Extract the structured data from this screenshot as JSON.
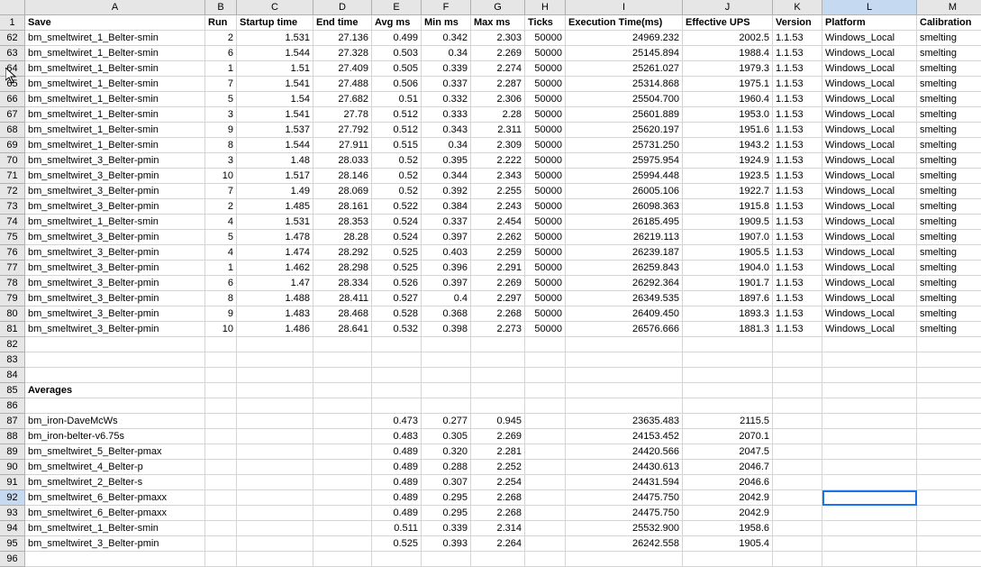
{
  "columns": [
    "",
    "A",
    "B",
    "C",
    "D",
    "E",
    "F",
    "G",
    "H",
    "I",
    "J",
    "K",
    "L",
    "M"
  ],
  "active_column_index": 12,
  "headers": {
    "row": 1,
    "cells": [
      "Save",
      "Run",
      "Startup time",
      "End time",
      "Avg ms",
      "Min ms",
      "Max ms",
      "Ticks",
      "Execution Time(ms)",
      "Effective UPS",
      "Version",
      "Platform",
      "Calibration"
    ]
  },
  "rows": [
    {
      "r": 62,
      "a": "bm_smeltwiret_1_Belter-smin",
      "b": "2",
      "c": "1.531",
      "d": "27.136",
      "e": "0.499",
      "f": "0.342",
      "g": "2.303",
      "h": "50000",
      "i": "24969.232",
      "j": "2002.5",
      "k": "1.1.53",
      "l": "Windows_Local",
      "m": "smelting"
    },
    {
      "r": 63,
      "a": "bm_smeltwiret_1_Belter-smin",
      "b": "6",
      "c": "1.544",
      "d": "27.328",
      "e": "0.503",
      "f": "0.34",
      "g": "2.269",
      "h": "50000",
      "i": "25145.894",
      "j": "1988.4",
      "k": "1.1.53",
      "l": "Windows_Local",
      "m": "smelting"
    },
    {
      "r": 64,
      "a": "bm_smeltwiret_1_Belter-smin",
      "b": "1",
      "c": "1.51",
      "d": "27.409",
      "e": "0.505",
      "f": "0.339",
      "g": "2.274",
      "h": "50000",
      "i": "25261.027",
      "j": "1979.3",
      "k": "1.1.53",
      "l": "Windows_Local",
      "m": "smelting"
    },
    {
      "r": 65,
      "a": "bm_smeltwiret_1_Belter-smin",
      "b": "7",
      "c": "1.541",
      "d": "27.488",
      "e": "0.506",
      "f": "0.337",
      "g": "2.287",
      "h": "50000",
      "i": "25314.868",
      "j": "1975.1",
      "k": "1.1.53",
      "l": "Windows_Local",
      "m": "smelting"
    },
    {
      "r": 66,
      "a": "bm_smeltwiret_1_Belter-smin",
      "b": "5",
      "c": "1.54",
      "d": "27.682",
      "e": "0.51",
      "f": "0.332",
      "g": "2.306",
      "h": "50000",
      "i": "25504.700",
      "j": "1960.4",
      "k": "1.1.53",
      "l": "Windows_Local",
      "m": "smelting"
    },
    {
      "r": 67,
      "a": "bm_smeltwiret_1_Belter-smin",
      "b": "3",
      "c": "1.541",
      "d": "27.78",
      "e": "0.512",
      "f": "0.333",
      "g": "2.28",
      "h": "50000",
      "i": "25601.889",
      "j": "1953.0",
      "k": "1.1.53",
      "l": "Windows_Local",
      "m": "smelting"
    },
    {
      "r": 68,
      "a": "bm_smeltwiret_1_Belter-smin",
      "b": "9",
      "c": "1.537",
      "d": "27.792",
      "e": "0.512",
      "f": "0.343",
      "g": "2.311",
      "h": "50000",
      "i": "25620.197",
      "j": "1951.6",
      "k": "1.1.53",
      "l": "Windows_Local",
      "m": "smelting"
    },
    {
      "r": 69,
      "a": "bm_smeltwiret_1_Belter-smin",
      "b": "8",
      "c": "1.544",
      "d": "27.911",
      "e": "0.515",
      "f": "0.34",
      "g": "2.309",
      "h": "50000",
      "i": "25731.250",
      "j": "1943.2",
      "k": "1.1.53",
      "l": "Windows_Local",
      "m": "smelting"
    },
    {
      "r": 70,
      "a": "bm_smeltwiret_3_Belter-pmin",
      "b": "3",
      "c": "1.48",
      "d": "28.033",
      "e": "0.52",
      "f": "0.395",
      "g": "2.222",
      "h": "50000",
      "i": "25975.954",
      "j": "1924.9",
      "k": "1.1.53",
      "l": "Windows_Local",
      "m": "smelting"
    },
    {
      "r": 71,
      "a": "bm_smeltwiret_3_Belter-pmin",
      "b": "10",
      "c": "1.517",
      "d": "28.146",
      "e": "0.52",
      "f": "0.344",
      "g": "2.343",
      "h": "50000",
      "i": "25994.448",
      "j": "1923.5",
      "k": "1.1.53",
      "l": "Windows_Local",
      "m": "smelting"
    },
    {
      "r": 72,
      "a": "bm_smeltwiret_3_Belter-pmin",
      "b": "7",
      "c": "1.49",
      "d": "28.069",
      "e": "0.52",
      "f": "0.392",
      "g": "2.255",
      "h": "50000",
      "i": "26005.106",
      "j": "1922.7",
      "k": "1.1.53",
      "l": "Windows_Local",
      "m": "smelting"
    },
    {
      "r": 73,
      "a": "bm_smeltwiret_3_Belter-pmin",
      "b": "2",
      "c": "1.485",
      "d": "28.161",
      "e": "0.522",
      "f": "0.384",
      "g": "2.243",
      "h": "50000",
      "i": "26098.363",
      "j": "1915.8",
      "k": "1.1.53",
      "l": "Windows_Local",
      "m": "smelting"
    },
    {
      "r": 74,
      "a": "bm_smeltwiret_1_Belter-smin",
      "b": "4",
      "c": "1.531",
      "d": "28.353",
      "e": "0.524",
      "f": "0.337",
      "g": "2.454",
      "h": "50000",
      "i": "26185.495",
      "j": "1909.5",
      "k": "1.1.53",
      "l": "Windows_Local",
      "m": "smelting"
    },
    {
      "r": 75,
      "a": "bm_smeltwiret_3_Belter-pmin",
      "b": "5",
      "c": "1.478",
      "d": "28.28",
      "e": "0.524",
      "f": "0.397",
      "g": "2.262",
      "h": "50000",
      "i": "26219.113",
      "j": "1907.0",
      "k": "1.1.53",
      "l": "Windows_Local",
      "m": "smelting"
    },
    {
      "r": 76,
      "a": "bm_smeltwiret_3_Belter-pmin",
      "b": "4",
      "c": "1.474",
      "d": "28.292",
      "e": "0.525",
      "f": "0.403",
      "g": "2.259",
      "h": "50000",
      "i": "26239.187",
      "j": "1905.5",
      "k": "1.1.53",
      "l": "Windows_Local",
      "m": "smelting"
    },
    {
      "r": 77,
      "a": "bm_smeltwiret_3_Belter-pmin",
      "b": "1",
      "c": "1.462",
      "d": "28.298",
      "e": "0.525",
      "f": "0.396",
      "g": "2.291",
      "h": "50000",
      "i": "26259.843",
      "j": "1904.0",
      "k": "1.1.53",
      "l": "Windows_Local",
      "m": "smelting"
    },
    {
      "r": 78,
      "a": "bm_smeltwiret_3_Belter-pmin",
      "b": "6",
      "c": "1.47",
      "d": "28.334",
      "e": "0.526",
      "f": "0.397",
      "g": "2.269",
      "h": "50000",
      "i": "26292.364",
      "j": "1901.7",
      "k": "1.1.53",
      "l": "Windows_Local",
      "m": "smelting"
    },
    {
      "r": 79,
      "a": "bm_smeltwiret_3_Belter-pmin",
      "b": "8",
      "c": "1.488",
      "d": "28.411",
      "e": "0.527",
      "f": "0.4",
      "g": "2.297",
      "h": "50000",
      "i": "26349.535",
      "j": "1897.6",
      "k": "1.1.53",
      "l": "Windows_Local",
      "m": "smelting"
    },
    {
      "r": 80,
      "a": "bm_smeltwiret_3_Belter-pmin",
      "b": "9",
      "c": "1.483",
      "d": "28.468",
      "e": "0.528",
      "f": "0.368",
      "g": "2.268",
      "h": "50000",
      "i": "26409.450",
      "j": "1893.3",
      "k": "1.1.53",
      "l": "Windows_Local",
      "m": "smelting"
    },
    {
      "r": 81,
      "a": "bm_smeltwiret_3_Belter-pmin",
      "b": "10",
      "c": "1.486",
      "d": "28.641",
      "e": "0.532",
      "f": "0.398",
      "g": "2.273",
      "h": "50000",
      "i": "26576.666",
      "j": "1881.3",
      "k": "1.1.53",
      "l": "Windows_Local",
      "m": "smelting"
    },
    {
      "r": 82
    },
    {
      "r": 83
    },
    {
      "r": 84
    },
    {
      "r": 85,
      "a": "Averages",
      "bold": true
    },
    {
      "r": 86
    },
    {
      "r": 87,
      "a": "bm_iron-DaveMcWs",
      "e": "0.473",
      "f": "0.277",
      "g": "0.945",
      "i": "23635.483",
      "j": "2115.5"
    },
    {
      "r": 88,
      "a": "bm_iron-belter-v6.75s",
      "e": "0.483",
      "f": "0.305",
      "g": "2.269",
      "i": "24153.452",
      "j": "2070.1"
    },
    {
      "r": 89,
      "a": "bm_smeltwiret_5_Belter-pmax",
      "e": "0.489",
      "f": "0.320",
      "g": "2.281",
      "i": "24420.566",
      "j": "2047.5"
    },
    {
      "r": 90,
      "a": "bm_smeltwiret_4_Belter-p",
      "e": "0.489",
      "f": "0.288",
      "g": "2.252",
      "i": "24430.613",
      "j": "2046.7"
    },
    {
      "r": 91,
      "a": "bm_smeltwiret_2_Belter-s",
      "e": "0.489",
      "f": "0.307",
      "g": "2.254",
      "i": "24431.594",
      "j": "2046.6"
    },
    {
      "r": 92,
      "a": "bm_smeltwiret_6_Belter-pmaxx",
      "e": "0.489",
      "f": "0.295",
      "g": "2.268",
      "i": "24475.750",
      "j": "2042.9",
      "active": true,
      "selected_col": "l"
    },
    {
      "r": 93,
      "a": "bm_smeltwiret_6_Belter-pmaxx",
      "e": "0.489",
      "f": "0.295",
      "g": "2.268",
      "i": "24475.750",
      "j": "2042.9"
    },
    {
      "r": 94,
      "a": "bm_smeltwiret_1_Belter-smin",
      "e": "0.511",
      "f": "0.339",
      "g": "2.314",
      "i": "25532.900",
      "j": "1958.6"
    },
    {
      "r": 95,
      "a": "bm_smeltwiret_3_Belter-pmin",
      "e": "0.525",
      "f": "0.393",
      "g": "2.264",
      "i": "26242.558",
      "j": "1905.4"
    },
    {
      "r": 96
    }
  ]
}
